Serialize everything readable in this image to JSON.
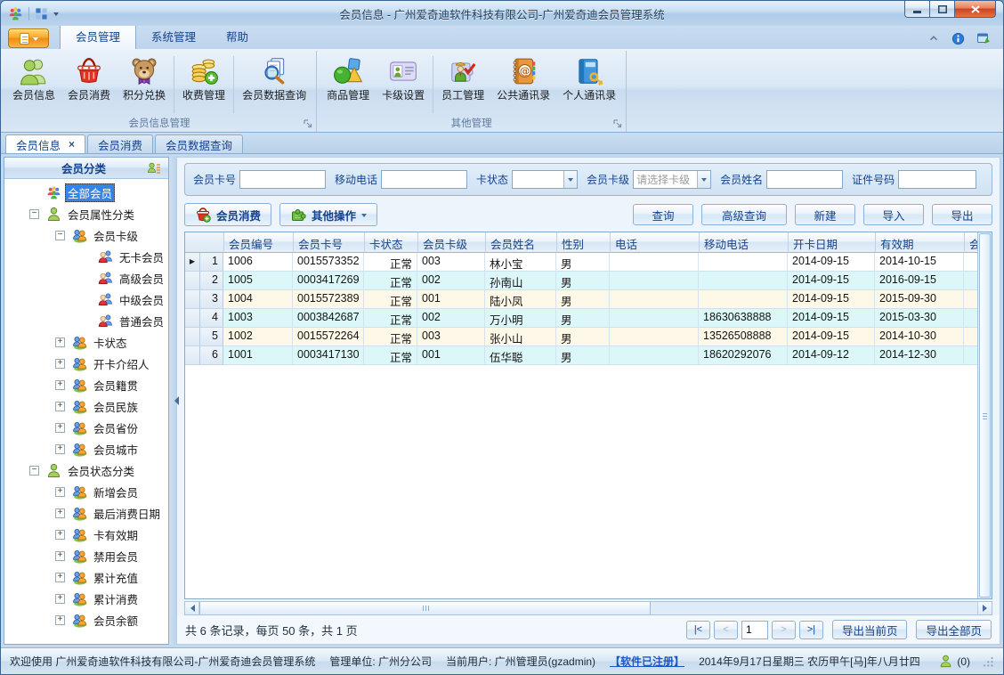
{
  "window": {
    "title": "会员信息 - 广州爱奇迪软件科技有限公司-广州爱奇迪会员管理系统"
  },
  "menu": {
    "tabs": [
      {
        "label": "会员管理",
        "active": true
      },
      {
        "label": "系统管理",
        "active": false
      },
      {
        "label": "帮助",
        "active": false
      }
    ]
  },
  "ribbon": {
    "groups": [
      {
        "title": "会员信息管理",
        "items": [
          {
            "label": "会员信息",
            "icon": "members-icon"
          },
          {
            "label": "会员消费",
            "icon": "basket-icon"
          },
          {
            "label": "积分兑换",
            "icon": "teddy-bear-icon"
          },
          {
            "label": "收费管理",
            "icon": "coins-icon"
          },
          {
            "label": "会员数据查询",
            "icon": "search-documents-icon"
          }
        ]
      },
      {
        "title": "其他管理",
        "items": [
          {
            "label": "商品管理",
            "icon": "shapes-icon"
          },
          {
            "label": "卡级设置",
            "icon": "id-card-icon"
          },
          {
            "label": "员工管理",
            "icon": "employee-icon"
          },
          {
            "label": "公共通讯录",
            "icon": "address-book-icon"
          },
          {
            "label": "个人通讯录",
            "icon": "personal-book-icon"
          }
        ]
      }
    ]
  },
  "doc_tabs": [
    {
      "label": "会员信息",
      "active": true
    },
    {
      "label": "会员消费",
      "active": false
    },
    {
      "label": "会员数据查询",
      "active": false
    }
  ],
  "sidebar": {
    "title": "会员分类",
    "tree": [
      {
        "label": "全部会员",
        "level": 0,
        "icon": "group",
        "expand": "",
        "selected": true
      },
      {
        "label": "会员属性分类",
        "level": 0,
        "icon": "person",
        "expand": "-"
      },
      {
        "label": "会员卡级",
        "level": 1,
        "icon": "pair",
        "expand": "-"
      },
      {
        "label": "无卡会员",
        "level": 2,
        "icon": "member",
        "expand": ""
      },
      {
        "label": "高级会员",
        "level": 2,
        "icon": "member",
        "expand": ""
      },
      {
        "label": "中级会员",
        "level": 2,
        "icon": "member",
        "expand": ""
      },
      {
        "label": "普通会员",
        "level": 2,
        "icon": "member",
        "expand": ""
      },
      {
        "label": "卡状态",
        "level": 1,
        "icon": "pair",
        "expand": "+"
      },
      {
        "label": "开卡介绍人",
        "level": 1,
        "icon": "pair",
        "expand": "+"
      },
      {
        "label": "会员籍贯",
        "level": 1,
        "icon": "pair",
        "expand": "+"
      },
      {
        "label": "会员民族",
        "level": 1,
        "icon": "pair",
        "expand": "+"
      },
      {
        "label": "会员省份",
        "level": 1,
        "icon": "pair",
        "expand": "+"
      },
      {
        "label": "会员城市",
        "level": 1,
        "icon": "pair",
        "expand": "+"
      },
      {
        "label": "会员状态分类",
        "level": 0,
        "icon": "person",
        "expand": "-"
      },
      {
        "label": "新增会员",
        "level": 1,
        "icon": "pair",
        "expand": "+"
      },
      {
        "label": "最后消费日期",
        "level": 1,
        "icon": "pair",
        "expand": "+"
      },
      {
        "label": "卡有效期",
        "level": 1,
        "icon": "pair",
        "expand": "+"
      },
      {
        "label": "禁用会员",
        "level": 1,
        "icon": "pair",
        "expand": "+"
      },
      {
        "label": "累计充值",
        "level": 1,
        "icon": "pair",
        "expand": "+"
      },
      {
        "label": "累计消费",
        "level": 1,
        "icon": "pair",
        "expand": "+"
      },
      {
        "label": "会员余额",
        "level": 1,
        "icon": "pair",
        "expand": "+"
      }
    ]
  },
  "filters": {
    "card_no_label": "会员卡号",
    "mobile_label": "移动电话",
    "card_status_label": "卡状态",
    "card_status_value": "",
    "card_level_label": "会员卡级",
    "card_level_value": "请选择卡级",
    "name_label": "会员姓名",
    "id_no_label": "证件号码"
  },
  "toolbar": {
    "member_consume": "会员消费",
    "other_ops": "其他操作",
    "query": "查询",
    "adv_query": "高级查询",
    "new": "新建",
    "import": "导入",
    "export": "导出"
  },
  "table": {
    "columns": [
      "会员编号",
      "会员卡号",
      "卡状态",
      "会员卡级",
      "会员姓名",
      "性别",
      "电话",
      "移动电话",
      "开卡日期",
      "有效期",
      "会员"
    ],
    "rows": [
      {
        "num": 1,
        "current": true,
        "cells": [
          "1006",
          "0015573352",
          "正常",
          "003",
          "林小宝",
          "男",
          "",
          "",
          "2014-09-15",
          "2014-10-15",
          ""
        ]
      },
      {
        "num": 2,
        "current": false,
        "cells": [
          "1005",
          "0003417269",
          "正常",
          "002",
          "孙南山",
          "男",
          "",
          "",
          "2014-09-15",
          "2016-09-15",
          ""
        ]
      },
      {
        "num": 3,
        "current": false,
        "cells": [
          "1004",
          "0015572389",
          "正常",
          "001",
          "陆小凤",
          "男",
          "",
          "",
          "2014-09-15",
          "2015-09-30",
          ""
        ]
      },
      {
        "num": 4,
        "current": false,
        "cells": [
          "1003",
          "0003842687",
          "正常",
          "002",
          "万小明",
          "男",
          "",
          "18630638888",
          "2014-09-15",
          "2015-03-30",
          ""
        ]
      },
      {
        "num": 5,
        "current": false,
        "cells": [
          "1002",
          "0015572264",
          "正常",
          "003",
          "张小山",
          "男",
          "",
          "13526508888",
          "2014-09-15",
          "2014-10-30",
          ""
        ]
      },
      {
        "num": 6,
        "current": false,
        "cells": [
          "1001",
          "0003417130",
          "正常",
          "001",
          "伍华聪",
          "男",
          "",
          "18620292076",
          "2014-09-12",
          "2014-12-30",
          ""
        ]
      }
    ]
  },
  "pagination": {
    "summary": "共 6 条记录，每页 50 条，共 1 页",
    "first": "|<",
    "prev": "<",
    "page": "1",
    "next": ">",
    "last": ">|",
    "export_current": "导出当前页",
    "export_all": "导出全部页"
  },
  "statusbar": {
    "welcome": "欢迎使用 广州爱奇迪软件科技有限公司-广州爱奇迪会员管理系统",
    "org": "管理单位: 广州分公司",
    "user": "当前用户: 广州管理员(gzadmin)",
    "registered": "【软件已注册】",
    "date": "2014年9月17日星期三 农历甲午[马]年八月廿四",
    "msg_count": "(0)"
  }
}
